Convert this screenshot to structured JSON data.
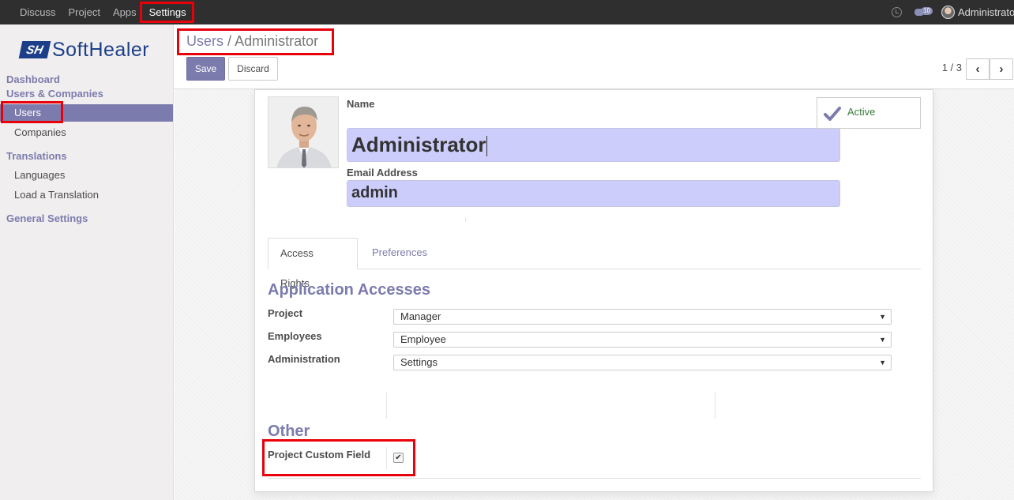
{
  "topbar": {
    "menu": [
      "Discuss",
      "Project",
      "Apps",
      "Settings"
    ],
    "active_menu": "Settings",
    "chat_badge": "10",
    "user_name": "Administrator"
  },
  "sidebar": {
    "logo_mark": "SH",
    "logo_text": "SoftHealer",
    "dashboard": "Dashboard",
    "users_companies": "Users & Companies",
    "users": "Users",
    "companies": "Companies",
    "translations": "Translations",
    "languages": "Languages",
    "load_translation": "Load a Translation",
    "general_settings": "General Settings"
  },
  "control": {
    "breadcrumb_parent": "Users",
    "breadcrumb_sep": "/",
    "breadcrumb_current": "Administrator",
    "save_label": "Save",
    "discard_label": "Discard",
    "pager": "1 / 3"
  },
  "form": {
    "name_label": "Name",
    "name_value": "Administrator",
    "email_label": "Email Address",
    "email_value": "admin",
    "active_label": "Active",
    "tabs": [
      "Access Rights",
      "Preferences"
    ],
    "section_app": "Application Accesses",
    "accesses": [
      {
        "label": "Project",
        "value": "Manager"
      },
      {
        "label": "Employees",
        "value": "Employee"
      },
      {
        "label": "Administration",
        "value": "Settings"
      }
    ],
    "section_other": "Other",
    "custom_field_label": "Project Custom Field",
    "custom_field_checked": "✔"
  },
  "colors": {
    "brand": "#7c7bad",
    "input_bg": "#cccdfb",
    "highlight": "#e8000b",
    "topbar": "#2f2f2f"
  }
}
